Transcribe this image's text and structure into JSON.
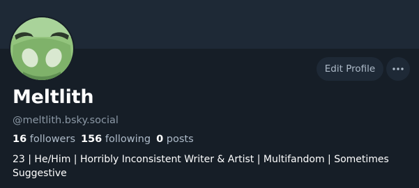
{
  "profile": {
    "display_name": "Meltlith",
    "handle": "@meltlith.bsky.social",
    "avatar_icon": "green-creature-avatar",
    "followers_count": "16",
    "followers_label": "followers",
    "following_count": "156",
    "following_label": "following",
    "posts_count": "0",
    "posts_label": "posts",
    "bio": "23 | He/Him | Horribly Inconsistent Writer & Artist | Multifandom |  Sometimes Suggestive"
  },
  "actions": {
    "edit_label": "Edit Profile",
    "more_icon": "ellipsis-icon"
  },
  "colors": {
    "background": "#161e27",
    "banner": "#1e2936",
    "button_bg": "#1e2936",
    "muted_text": "#8b98a5",
    "avatar_green": "#7fb26a"
  }
}
